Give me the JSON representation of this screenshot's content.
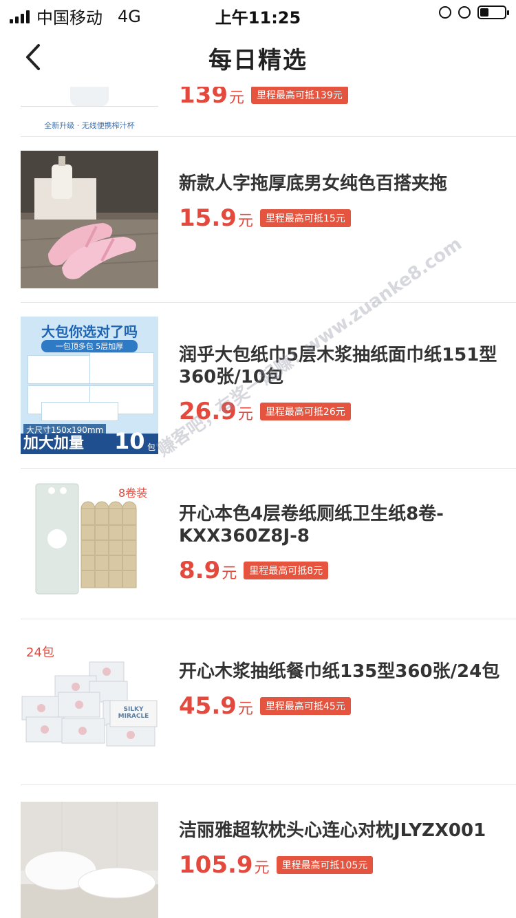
{
  "status_bar": {
    "carrier": "中国移动",
    "network": "4G",
    "time": "上午11:25"
  },
  "nav": {
    "title": "每日精选"
  },
  "top_partial": {
    "image_caption": "全新升级 · 无线便携榨汁杯",
    "price": "139",
    "unit": "元",
    "tag": "里程最高可抵139元"
  },
  "products": [
    {
      "title": "新款人字拖厚底男女纯色百搭夹拖",
      "price": "15.9",
      "unit": "元",
      "tag": "里程最高可抵15元",
      "image": "pink-flip-flops"
    },
    {
      "title": "润乎大包纸巾5层木浆抽纸面巾纸151型360张/10包",
      "price": "26.9",
      "unit": "元",
      "tag": "里程最高可抵26元",
      "image": "tissue-pack",
      "image_text": {
        "headline": "大包你选对了吗",
        "sub": "一包顶多包 5层加厚",
        "size": "大尺寸150x190mm",
        "promo": "加大加量",
        "count": "10",
        "count_unit": "包"
      }
    },
    {
      "title": "开心本色4层卷纸厕纸卫生纸8卷-KXX360Z8J-8",
      "price": "8.9",
      "unit": "元",
      "tag": "里程最高可抵8元",
      "image": "toilet-paper-rolls",
      "image_text": {
        "label": "8卷装"
      }
    },
    {
      "title": "开心木浆抽纸餐巾纸135型360张/24包",
      "price": "45.9",
      "unit": "元",
      "tag": "里程最高可抵45元",
      "image": "napkin-packs",
      "image_text": {
        "label": "24包",
        "brand": "SILKY MIRACLE"
      }
    },
    {
      "title": "洁丽雅超软枕头心连心对枕JLYZX001",
      "price": "105.9",
      "unit": "元",
      "tag": "里程最高可抵105元",
      "image": "pillows"
    }
  ],
  "watermark": "赚客吧，有奖一起赚！www.zuanke8.com",
  "colors": {
    "price": "#e4493d",
    "tag_bg": "#e5543e",
    "divider": "#e6e6e6"
  },
  "icons": [
    "signal-icon",
    "back-arrow-icon",
    "rotation-lock-icon",
    "alarm-icon",
    "battery-icon"
  ]
}
